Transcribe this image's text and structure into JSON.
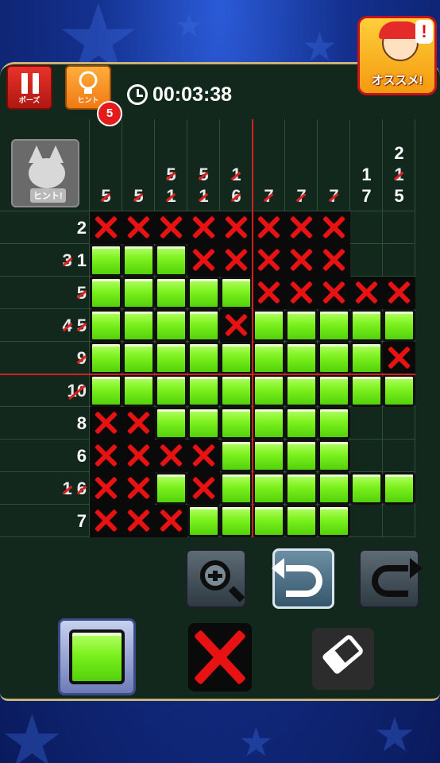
{
  "header": {
    "pause_label": "ポーズ",
    "hint_label": "ヒント",
    "hint_count": "5",
    "timer": "00:03:38",
    "recommend_label": "オススメ!",
    "recommend_badge": "!"
  },
  "hint_image_label": "ヒント!",
  "puzzle": {
    "columns": 10,
    "rows": 10,
    "col_hints": [
      [
        {
          "v": "5",
          "done": true
        }
      ],
      [
        {
          "v": "5",
          "done": true
        }
      ],
      [
        {
          "v": "5",
          "done": true
        },
        {
          "v": "1",
          "done": true
        }
      ],
      [
        {
          "v": "5",
          "done": true
        },
        {
          "v": "1",
          "done": true
        }
      ],
      [
        {
          "v": "1",
          "done": true
        },
        {
          "v": "6",
          "done": true
        }
      ],
      [
        {
          "v": "7",
          "done": true
        }
      ],
      [
        {
          "v": "7",
          "done": true
        }
      ],
      [
        {
          "v": "7",
          "done": true
        }
      ],
      [
        {
          "v": "1",
          "done": false
        },
        {
          "v": "7",
          "done": false
        }
      ],
      [
        {
          "v": "2",
          "done": false
        },
        {
          "v": "1",
          "done": true
        },
        {
          "v": "5",
          "done": false
        }
      ]
    ],
    "row_hints": [
      [
        {
          "v": "2",
          "done": false
        }
      ],
      [
        {
          "v": "3",
          "done": true
        },
        {
          "v": "1",
          "done": false
        }
      ],
      [
        {
          "v": "5",
          "done": true
        }
      ],
      [
        {
          "v": "4",
          "done": true
        },
        {
          "v": "5",
          "done": true
        }
      ],
      [
        {
          "v": "9",
          "done": true
        }
      ],
      [
        {
          "v": "10",
          "done": true
        }
      ],
      [
        {
          "v": "8",
          "done": false
        }
      ],
      [
        {
          "v": "6",
          "done": false
        }
      ],
      [
        {
          "v": "1",
          "done": true
        },
        {
          "v": "6",
          "done": true
        }
      ],
      [
        {
          "v": "7",
          "done": false
        }
      ]
    ],
    "grid": [
      "XXXXXXXX..",
      "FFFXXXXX..",
      "FFFFFXXXXX",
      "FFFFXFFFFF",
      "FFFFFFFFFX",
      "FFFFFFFFFF",
      "XXFFFFFF..",
      "XXXXFFFF..",
      "XXFXFFFFFF",
      "XXXFFFFF.."
    ]
  },
  "tools": {
    "zoom": "zoom-in",
    "undo": "undo",
    "redo": "redo"
  },
  "modes": {
    "selected": "fill",
    "list": [
      "fill",
      "cross",
      "erase"
    ]
  }
}
